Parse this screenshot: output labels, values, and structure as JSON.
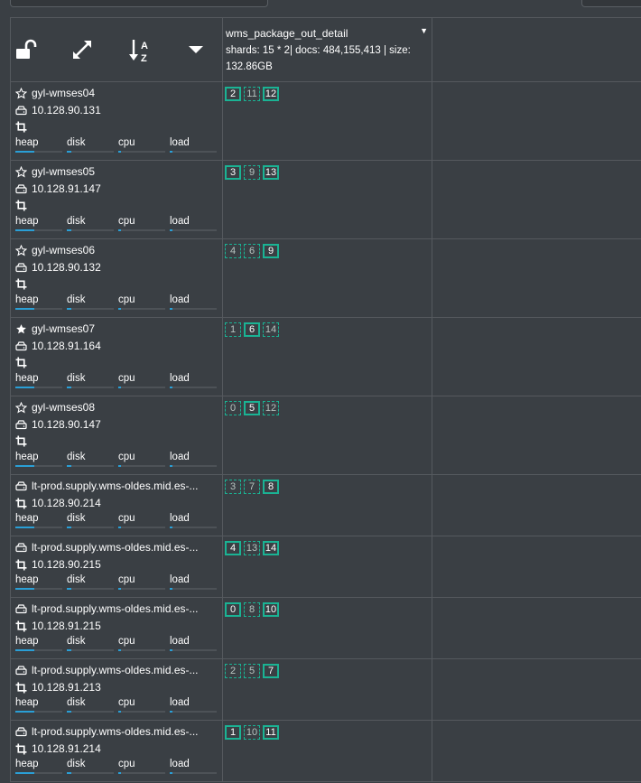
{
  "header": {
    "sort_icon_text": "A Z",
    "index": {
      "name": "wms_package_out_detail",
      "stats": "shards: 15 * 2| docs: 484,155,413 | size: 132.86GB"
    }
  },
  "metric_labels": [
    "heap",
    "disk",
    "cpu",
    "load"
  ],
  "colors": {
    "accent": "#1ab394",
    "bar": "#2a9fd6",
    "background": "#3a3f44"
  },
  "nodes": [
    {
      "name": "gyl-wmses04",
      "ip": "10.128.90.131",
      "master": false,
      "data_node": true,
      "metrics": [
        0.4,
        0.1,
        0.05,
        0.05
      ],
      "shards": [
        {
          "n": "2",
          "p": true
        },
        {
          "n": "11",
          "p": false
        },
        {
          "n": "12",
          "p": true
        }
      ]
    },
    {
      "name": "gyl-wmses05",
      "ip": "10.128.91.147",
      "master": false,
      "data_node": true,
      "metrics": [
        0.4,
        0.1,
        0.05,
        0.05
      ],
      "shards": [
        {
          "n": "3",
          "p": true
        },
        {
          "n": "9",
          "p": false
        },
        {
          "n": "13",
          "p": true
        }
      ]
    },
    {
      "name": "gyl-wmses06",
      "ip": "10.128.90.132",
      "master": false,
      "data_node": true,
      "metrics": [
        0.4,
        0.1,
        0.05,
        0.05
      ],
      "shards": [
        {
          "n": "4",
          "p": false
        },
        {
          "n": "6",
          "p": false
        },
        {
          "n": "9",
          "p": true
        }
      ]
    },
    {
      "name": "gyl-wmses07",
      "ip": "10.128.91.164",
      "master": true,
      "data_node": true,
      "metrics": [
        0.4,
        0.1,
        0.05,
        0.05
      ],
      "shards": [
        {
          "n": "1",
          "p": false
        },
        {
          "n": "6",
          "p": true
        },
        {
          "n": "14",
          "p": false
        }
      ]
    },
    {
      "name": "gyl-wmses08",
      "ip": "10.128.90.147",
      "master": false,
      "data_node": true,
      "metrics": [
        0.4,
        0.1,
        0.05,
        0.05
      ],
      "shards": [
        {
          "n": "0",
          "p": false
        },
        {
          "n": "5",
          "p": true
        },
        {
          "n": "12",
          "p": false
        }
      ]
    },
    {
      "name": "lt-prod.supply.wms-oldes.mid.es-...",
      "ip": "10.128.90.214",
      "master": false,
      "data_node": false,
      "metrics": [
        0.4,
        0.1,
        0.05,
        0.05
      ],
      "shards": [
        {
          "n": "3",
          "p": false
        },
        {
          "n": "7",
          "p": false
        },
        {
          "n": "8",
          "p": true
        }
      ]
    },
    {
      "name": "lt-prod.supply.wms-oldes.mid.es-...",
      "ip": "10.128.90.215",
      "master": false,
      "data_node": false,
      "metrics": [
        0.4,
        0.1,
        0.05,
        0.05
      ],
      "shards": [
        {
          "n": "4",
          "p": true
        },
        {
          "n": "13",
          "p": false
        },
        {
          "n": "14",
          "p": true
        }
      ]
    },
    {
      "name": "lt-prod.supply.wms-oldes.mid.es-...",
      "ip": "10.128.91.215",
      "master": false,
      "data_node": false,
      "metrics": [
        0.4,
        0.1,
        0.05,
        0.05
      ],
      "shards": [
        {
          "n": "0",
          "p": true
        },
        {
          "n": "8",
          "p": false
        },
        {
          "n": "10",
          "p": true
        }
      ]
    },
    {
      "name": "lt-prod.supply.wms-oldes.mid.es-...",
      "ip": "10.128.91.213",
      "master": false,
      "data_node": false,
      "metrics": [
        0.4,
        0.1,
        0.05,
        0.05
      ],
      "shards": [
        {
          "n": "2",
          "p": false
        },
        {
          "n": "5",
          "p": false
        },
        {
          "n": "7",
          "p": true
        }
      ]
    },
    {
      "name": "lt-prod.supply.wms-oldes.mid.es-...",
      "ip": "10.128.91.214",
      "master": false,
      "data_node": false,
      "metrics": [
        0.4,
        0.1,
        0.05,
        0.05
      ],
      "shards": [
        {
          "n": "1",
          "p": true
        },
        {
          "n": "10",
          "p": false
        },
        {
          "n": "11",
          "p": true
        }
      ]
    }
  ]
}
